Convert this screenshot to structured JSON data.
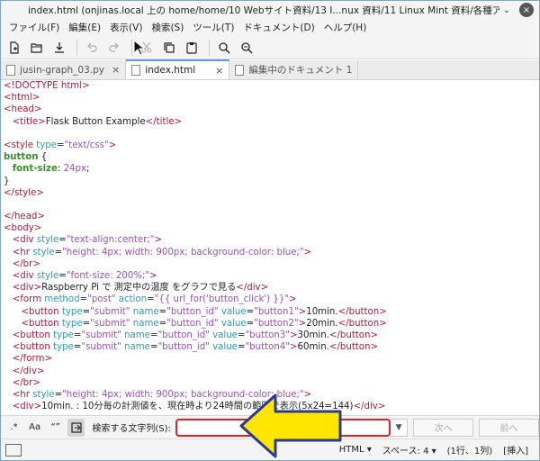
{
  "window": {
    "title": "index.html (onjinas.local 上の home/home/10 Webサイト資料/13 I...nux 資料/11 Linux Mint 資料/各種アプリの使い方/アプリ テスト用データ)",
    "minimize": "⌄",
    "close": "×"
  },
  "menu": {
    "items": [
      {
        "label": "ファイル(F)"
      },
      {
        "label": "編集(E)"
      },
      {
        "label": "表示(V)"
      },
      {
        "label": "検索(S)"
      },
      {
        "label": "ツール(T)"
      },
      {
        "label": "ドキュメント(D)"
      },
      {
        "label": "ヘルプ(H)"
      }
    ]
  },
  "toolbar": {
    "icons": [
      "new-document-icon",
      "open-folder-icon",
      "save-icon",
      "undo-icon",
      "redo-icon",
      "cut-icon",
      "copy-icon",
      "paste-icon",
      "search-icon",
      "replace-icon"
    ]
  },
  "tabs": [
    {
      "label": "jusin-graph_03.py",
      "active": false
    },
    {
      "label": "index.html",
      "active": true
    },
    {
      "label": "編集中のドキュメント 1",
      "active": false
    }
  ],
  "tab_close": "×",
  "editor": {
    "lines": [
      {
        "segs": [
          [
            "tag",
            "<!DOCTYPE html>"
          ]
        ]
      },
      {
        "segs": [
          [
            "tag",
            "<html>"
          ]
        ]
      },
      {
        "segs": [
          [
            "tag",
            "<head>"
          ]
        ]
      },
      {
        "segs": [
          [
            "",
            "   "
          ],
          [
            "tag",
            "<title>"
          ],
          [
            "",
            "Flask Button Example"
          ],
          [
            "tag",
            "</title>"
          ]
        ]
      },
      {
        "segs": [
          [
            "",
            ""
          ]
        ]
      },
      {
        "segs": [
          [
            "tag",
            "<style "
          ],
          [
            "attr",
            "type"
          ],
          [
            "",
            "="
          ],
          [
            "str",
            "\"text/css\""
          ],
          [
            "tag",
            ">"
          ]
        ]
      },
      {
        "segs": [
          [
            "kw",
            "button"
          ],
          [
            "",
            " {"
          ]
        ]
      },
      {
        "segs": [
          [
            "",
            "   "
          ],
          [
            "kw",
            "font-size"
          ],
          [
            "",
            ": "
          ],
          [
            "str",
            "24px"
          ],
          [
            "",
            ";"
          ]
        ]
      },
      {
        "segs": [
          [
            "",
            "}"
          ]
        ]
      },
      {
        "segs": [
          [
            "tag",
            "</style>"
          ]
        ]
      },
      {
        "segs": [
          [
            "",
            ""
          ]
        ]
      },
      {
        "segs": [
          [
            "tag",
            "</head>"
          ]
        ]
      },
      {
        "segs": [
          [
            "tag",
            "<body>"
          ]
        ]
      },
      {
        "segs": [
          [
            "",
            "   "
          ],
          [
            "tag",
            "<div "
          ],
          [
            "attr",
            "style"
          ],
          [
            "",
            "="
          ],
          [
            "str",
            "\"text-align:center;\""
          ],
          [
            "tag",
            ">"
          ]
        ]
      },
      {
        "segs": [
          [
            "",
            "   "
          ],
          [
            "tag",
            "<hr "
          ],
          [
            "attr",
            "style"
          ],
          [
            "",
            "="
          ],
          [
            "str",
            "\"height: 4px; width: 900px; background-color: blue;\""
          ],
          [
            "tag",
            ">"
          ]
        ]
      },
      {
        "segs": [
          [
            "",
            "   "
          ],
          [
            "tag",
            "</br>"
          ]
        ]
      },
      {
        "segs": [
          [
            "",
            "   "
          ],
          [
            "tag",
            "<div "
          ],
          [
            "attr",
            "style"
          ],
          [
            "",
            "="
          ],
          [
            "str",
            "\"font-size: 200%;\""
          ],
          [
            "tag",
            ">"
          ]
        ]
      },
      {
        "segs": [
          [
            "",
            "   "
          ],
          [
            "tag",
            "<div>"
          ],
          [
            "",
            "Raspberry Pi で 測定中の温度 をグラフで見る"
          ],
          [
            "tag",
            "</div>"
          ]
        ]
      },
      {
        "segs": [
          [
            "",
            "   "
          ],
          [
            "tag",
            "<form "
          ],
          [
            "attr",
            "method"
          ],
          [
            "",
            "="
          ],
          [
            "str",
            "\"post\""
          ],
          [
            "",
            " "
          ],
          [
            "attr",
            "action"
          ],
          [
            "",
            "="
          ],
          [
            "str",
            "\"{{ url_for('button_click') }}\""
          ],
          [
            "tag",
            ">"
          ]
        ]
      },
      {
        "segs": [
          [
            "",
            "      "
          ],
          [
            "tag",
            "<button "
          ],
          [
            "attr",
            "type"
          ],
          [
            "",
            "="
          ],
          [
            "str",
            "\"submit\""
          ],
          [
            "",
            " "
          ],
          [
            "attr",
            "name"
          ],
          [
            "",
            "="
          ],
          [
            "str",
            "\"button_id\""
          ],
          [
            "",
            " "
          ],
          [
            "attr",
            "value"
          ],
          [
            "",
            "="
          ],
          [
            "str",
            "\"button1\""
          ],
          [
            "tag",
            ">"
          ],
          [
            "",
            "10min."
          ],
          [
            "tag",
            "</button>"
          ]
        ]
      },
      {
        "segs": [
          [
            "",
            "      "
          ],
          [
            "tag",
            "<button "
          ],
          [
            "attr",
            "type"
          ],
          [
            "",
            "="
          ],
          [
            "str",
            "\"submit\""
          ],
          [
            "",
            " "
          ],
          [
            "attr",
            "name"
          ],
          [
            "",
            "="
          ],
          [
            "str",
            "\"button_id\""
          ],
          [
            "",
            " "
          ],
          [
            "attr",
            "value"
          ],
          [
            "",
            "="
          ],
          [
            "str",
            "\"button2\""
          ],
          [
            "tag",
            ">"
          ],
          [
            "",
            "20min."
          ],
          [
            "tag",
            "</button>"
          ]
        ]
      },
      {
        "segs": [
          [
            "",
            "   "
          ],
          [
            "tag",
            "<button "
          ],
          [
            "attr",
            "type"
          ],
          [
            "",
            "="
          ],
          [
            "str",
            "\"submit\""
          ],
          [
            "",
            " "
          ],
          [
            "attr",
            "name"
          ],
          [
            "",
            "="
          ],
          [
            "str",
            "\"button_id\""
          ],
          [
            "",
            " "
          ],
          [
            "attr",
            "value"
          ],
          [
            "",
            "="
          ],
          [
            "str",
            "\"button3\""
          ],
          [
            "tag",
            ">"
          ],
          [
            "",
            "30min."
          ],
          [
            "tag",
            "</button>"
          ]
        ]
      },
      {
        "segs": [
          [
            "",
            "   "
          ],
          [
            "tag",
            "<button "
          ],
          [
            "attr",
            "type"
          ],
          [
            "",
            "="
          ],
          [
            "str",
            "\"submit\""
          ],
          [
            "",
            " "
          ],
          [
            "attr",
            "name"
          ],
          [
            "",
            "="
          ],
          [
            "str",
            "\"button_id\""
          ],
          [
            "",
            " "
          ],
          [
            "attr",
            "value"
          ],
          [
            "",
            "="
          ],
          [
            "str",
            "\"button4\""
          ],
          [
            "tag",
            ">"
          ],
          [
            "",
            "60min."
          ],
          [
            "tag",
            "</button>"
          ]
        ]
      },
      {
        "segs": [
          [
            "",
            "   "
          ],
          [
            "tag",
            "</form>"
          ]
        ]
      },
      {
        "segs": [
          [
            "",
            "   "
          ],
          [
            "tag",
            "</div>"
          ]
        ]
      },
      {
        "segs": [
          [
            "",
            "   "
          ],
          [
            "tag",
            "</br>"
          ]
        ]
      },
      {
        "segs": [
          [
            "",
            "   "
          ],
          [
            "tag",
            "<hr "
          ],
          [
            "attr",
            "style"
          ],
          [
            "",
            "="
          ],
          [
            "str",
            "\"height: 4px; width: 900px; background-color: blue;\""
          ],
          [
            "tag",
            ">"
          ]
        ]
      },
      {
        "segs": [
          [
            "",
            "   "
          ],
          [
            "tag",
            "<div>"
          ],
          [
            "",
            "10min. : 10分毎の計測値を、現在時より24時間の範囲で表示(5x24=144)"
          ],
          [
            "tag",
            "</div>"
          ]
        ]
      }
    ]
  },
  "search": {
    "regex_label": ".*",
    "case_label": "Aa",
    "word_label": "“”",
    "label": "検索する文字列(S):",
    "value": "",
    "next_label": "次へ",
    "prev_label": "前へ"
  },
  "status": {
    "language": "HTML ▾",
    "spaces": "スペース: 4 ▾",
    "position": "(1行、1列)",
    "mode": "[挿入]"
  },
  "colors": {
    "arrow_fill": "#ffe600",
    "arrow_stroke": "#2a3a8f",
    "search_highlight": "#e0202a"
  }
}
